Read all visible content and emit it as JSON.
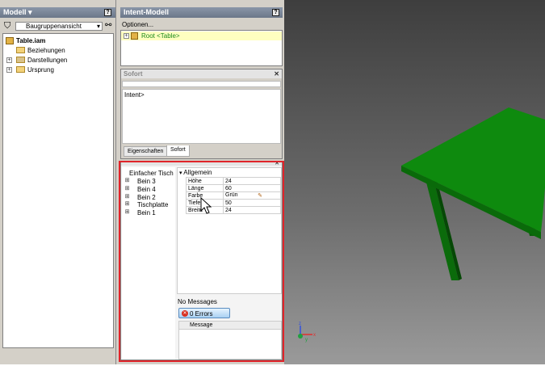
{
  "left_panel": {
    "title": "Modell",
    "view_dropdown": "Baugruppenansicht",
    "tree": [
      {
        "label": "Table.iam",
        "bold": true
      },
      {
        "label": "Beziehungen"
      },
      {
        "label": "Darstellungen"
      },
      {
        "label": "Ursprung"
      }
    ]
  },
  "intent_panel": {
    "title": "Intent-Modell",
    "options": "Optionen...",
    "root_label": "Root <Table>"
  },
  "sofort_panel": {
    "title": "Sofort",
    "prompt": "Intent>",
    "tabs": [
      "Eigenschaften",
      "Sofort"
    ]
  },
  "design_panel": {
    "tree": [
      "Einfacher Tisch",
      "Bein 3",
      "Bein 4",
      "Bein 2",
      "Tischplatte",
      "Bein 1"
    ],
    "group": "Allgemein",
    "properties": [
      {
        "name": "Höhe",
        "value": "24"
      },
      {
        "name": "Länge",
        "value": "60"
      },
      {
        "name": "Farbe",
        "value": "Grün"
      },
      {
        "name": "Tiefe",
        "value": "50"
      },
      {
        "name": "Breite",
        "value": "24"
      }
    ],
    "messages_label": "No Messages",
    "errors_button": "0 Errors",
    "message_header": "Message"
  },
  "colors": {
    "table_green": "#0e8a0e",
    "highlight_frame": "#e0242a"
  }
}
